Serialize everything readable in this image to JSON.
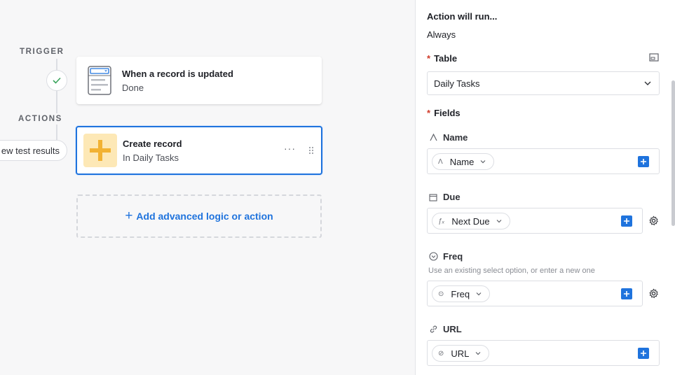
{
  "canvas": {
    "trigger_label": "TRIGGER",
    "actions_label": "ACTIONS",
    "test_results_label": "ew test results",
    "trigger": {
      "title": "When a record is updated",
      "status": "Done",
      "icon": "table-record-icon"
    },
    "action": {
      "title": "Create record",
      "subtitle": "In Daily Tasks",
      "menu": "···",
      "icon": "plus-icon"
    },
    "add_action_label": "Add advanced logic or action"
  },
  "panel": {
    "run_condition_label": "Action will run...",
    "run_condition_value": "Always",
    "table_label": "Table",
    "table_value": "Daily Tasks",
    "fields_label": "Fields",
    "required_mark": "*",
    "fields": [
      {
        "name": "Name",
        "chip": "Name",
        "icon": "text-field-icon"
      },
      {
        "name": "Due",
        "chip": "Next Due",
        "icon": "calendar-icon"
      },
      {
        "name": "Freq",
        "hint": "Use an existing select option, or enter a new one",
        "chip": "Freq",
        "icon": "select-field-icon"
      },
      {
        "name": "URL",
        "chip": "URL",
        "icon": "link-icon"
      }
    ]
  },
  "colors": {
    "accent": "#1f73dd",
    "required": "#d03b2a",
    "tile": "#fde8b6",
    "tile_plus": "#f2b233"
  }
}
